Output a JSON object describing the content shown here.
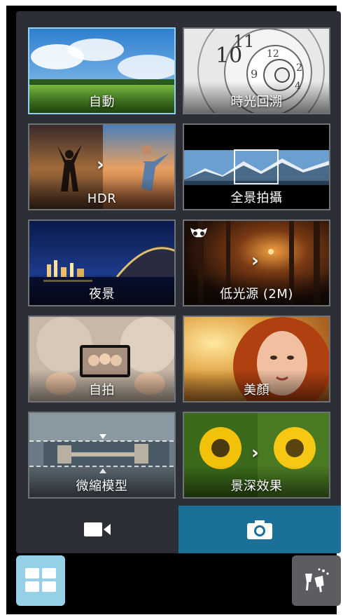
{
  "modes": [
    {
      "id": "auto",
      "label": "自動",
      "active": true
    },
    {
      "id": "time-rewind",
      "label": "時光回溯",
      "active": false
    },
    {
      "id": "hdr",
      "label": "HDR",
      "active": false
    },
    {
      "id": "panorama",
      "label": "全景拍攝",
      "active": false
    },
    {
      "id": "night",
      "label": "夜景",
      "active": false
    },
    {
      "id": "low-light",
      "label": "低光源 (2M)",
      "active": false
    },
    {
      "id": "selfie",
      "label": "自拍",
      "active": false
    },
    {
      "id": "beautification",
      "label": "美顏",
      "active": false
    },
    {
      "id": "miniature",
      "label": "微縮模型",
      "active": false
    },
    {
      "id": "depth-of-field",
      "label": "景深效果",
      "active": false
    }
  ],
  "tabs": {
    "video_icon": "video-camera-icon",
    "photo_icon": "photo-camera-icon",
    "selected": "photo"
  },
  "colors": {
    "panel": "#2c2f36",
    "active_tab": "#1b7098",
    "active_border": "#8fd0f4",
    "modes_button": "#96cfe8",
    "right_button": "#5b5d60"
  },
  "bottom_buttons": {
    "left_icon": "grid-modes-icon",
    "right_icon": "effects-icon"
  }
}
